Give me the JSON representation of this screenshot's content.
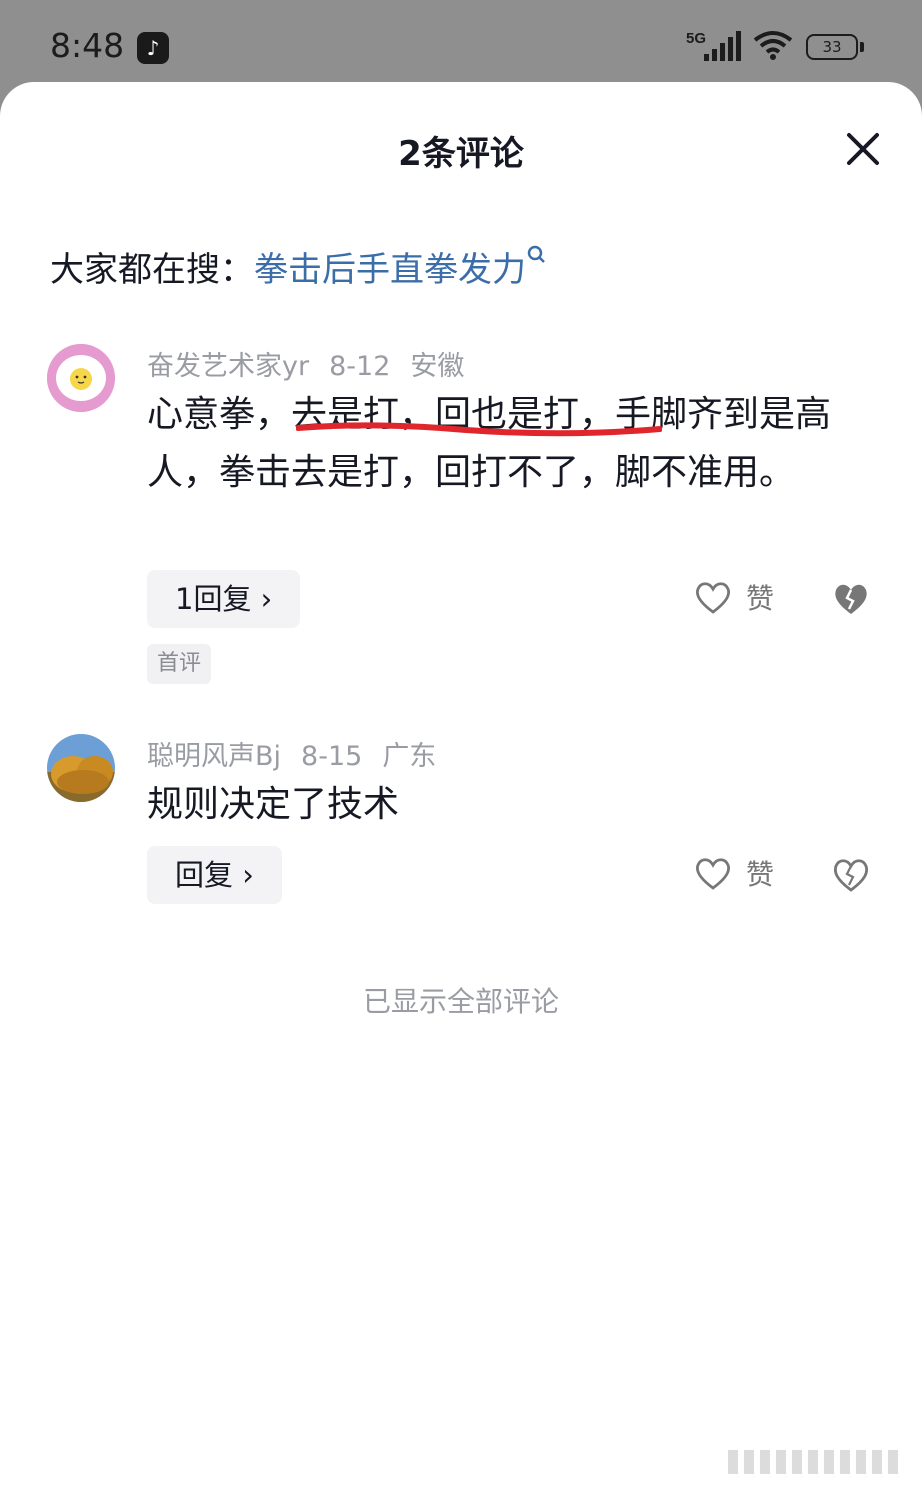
{
  "status": {
    "time": "8:48",
    "network": "5G",
    "battery": "33"
  },
  "sheet": {
    "title": "2条评论",
    "search_prefix": "大家都在搜：",
    "search_keyword": "拳击后手直拳发力",
    "footer": "已显示全部评论"
  },
  "comments": [
    {
      "username": "奋发艺术家yr",
      "date": "8-12",
      "location": "安徽",
      "text": "心意拳，去是打，回也是打，手脚齐到是高人，拳击去是打，回打不了，脚不准用。",
      "reply_label": "1回复 ›",
      "badge": "首评",
      "like_label": "赞"
    },
    {
      "username": "聪明风声Bj",
      "date": "8-15",
      "location": "广东",
      "text": "规则决定了技术",
      "reply_label": "回复 ›",
      "like_label": "赞"
    }
  ]
}
